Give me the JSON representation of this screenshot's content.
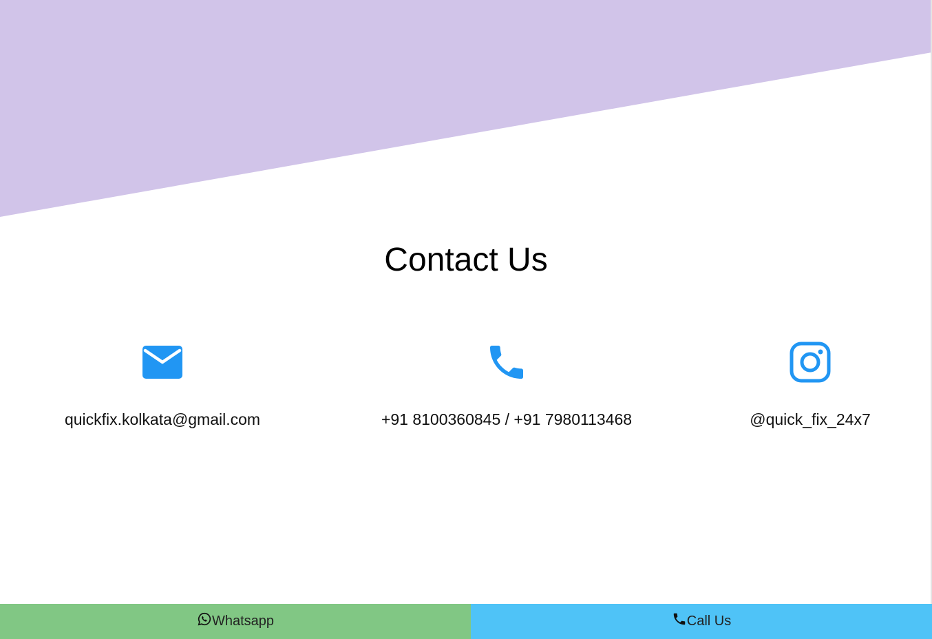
{
  "contact": {
    "title": "Contact Us",
    "email": {
      "icon": "mail-icon",
      "value": "quickfix.kolkata@gmail.com"
    },
    "phone": {
      "icon": "phone-icon",
      "value": "+91 8100360845 / +91 7980113468"
    },
    "instagram": {
      "icon": "instagram-icon",
      "value": "@quick_fix_24x7"
    }
  },
  "bottom_bar": {
    "whatsapp": {
      "label": "Whatsapp",
      "icon": "whatsapp-icon",
      "color": "#81c784"
    },
    "call": {
      "label": "Call Us",
      "icon": "phone-icon",
      "color": "#4fc3f7"
    }
  },
  "colors": {
    "hero": "#d1c4e9",
    "icon_accent": "#2196f3"
  }
}
